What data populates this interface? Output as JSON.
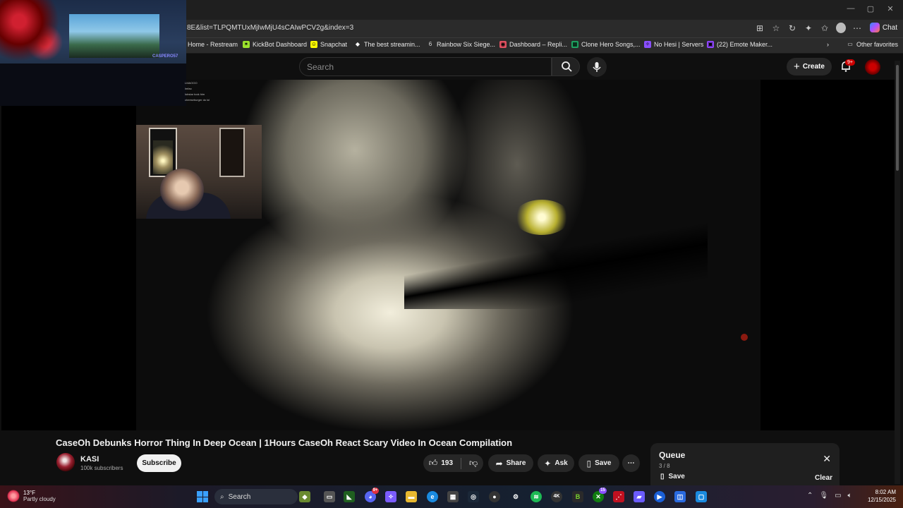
{
  "browser": {
    "url": "8E&list=TLPQMTUxMjIwMjU4sCAIwPCV2g&index=3",
    "chat_label": "Chat",
    "bookmarks": [
      {
        "label": "Home - Restream",
        "icon": "restream-icon",
        "color": "#2b2b2b"
      },
      {
        "label": "KickBot Dashboard",
        "icon": "kickbot-icon",
        "color": "#9be22d"
      },
      {
        "label": "Snapchat",
        "icon": "snapchat-icon",
        "color": "#fffc00"
      },
      {
        "label": "The best streamin...",
        "icon": "streamelements-icon",
        "color": "#ffffff"
      },
      {
        "label": "Rainbow Six Siege...",
        "icon": "r6-icon",
        "color": "#dddddd"
      },
      {
        "label": "Dashboard – Repli...",
        "icon": "replit-icon",
        "color": "#e05060"
      },
      {
        "label": "Clone Hero Songs,...",
        "icon": "sheets-icon",
        "color": "#1fa463"
      },
      {
        "label": "No Hesi | Servers",
        "icon": "nohesi-icon",
        "color": "#8a4fff"
      },
      {
        "label": "(22) Emote Maker...",
        "icon": "twitch-icon",
        "color": "#9146ff"
      }
    ],
    "other_favorites": "Other favorites"
  },
  "youtube": {
    "search_placeholder": "Search",
    "create_label": "Create",
    "notification_badge": "9+"
  },
  "overlay": {
    "neon_text": "CASPERO57",
    "chat_lines": [
      "LMAOOO",
      "lmfao",
      "lobstar took him",
      "cheeseburger do lol"
    ]
  },
  "video": {
    "title": "CaseOh Debunks Horror Thing In Deep Ocean | 1Hours CaseOh React Scary Video In Ocean Compilation",
    "channel_name": "KASI",
    "subscribers": "100k subscribers",
    "subscribe_label": "Subscribe",
    "likes": "193",
    "share_label": "Share",
    "ask_label": "Ask",
    "save_label": "Save"
  },
  "queue": {
    "title": "Queue",
    "count": "3 / 8",
    "save_label": "Save",
    "clear_label": "Clear"
  },
  "taskbar": {
    "temperature": "13°F",
    "weather": "Partly cloudy",
    "search_label": "Search",
    "time": "8:02 AM",
    "date": "12/15/2025",
    "discord_badge": "9+",
    "xbox_badge": "15"
  }
}
